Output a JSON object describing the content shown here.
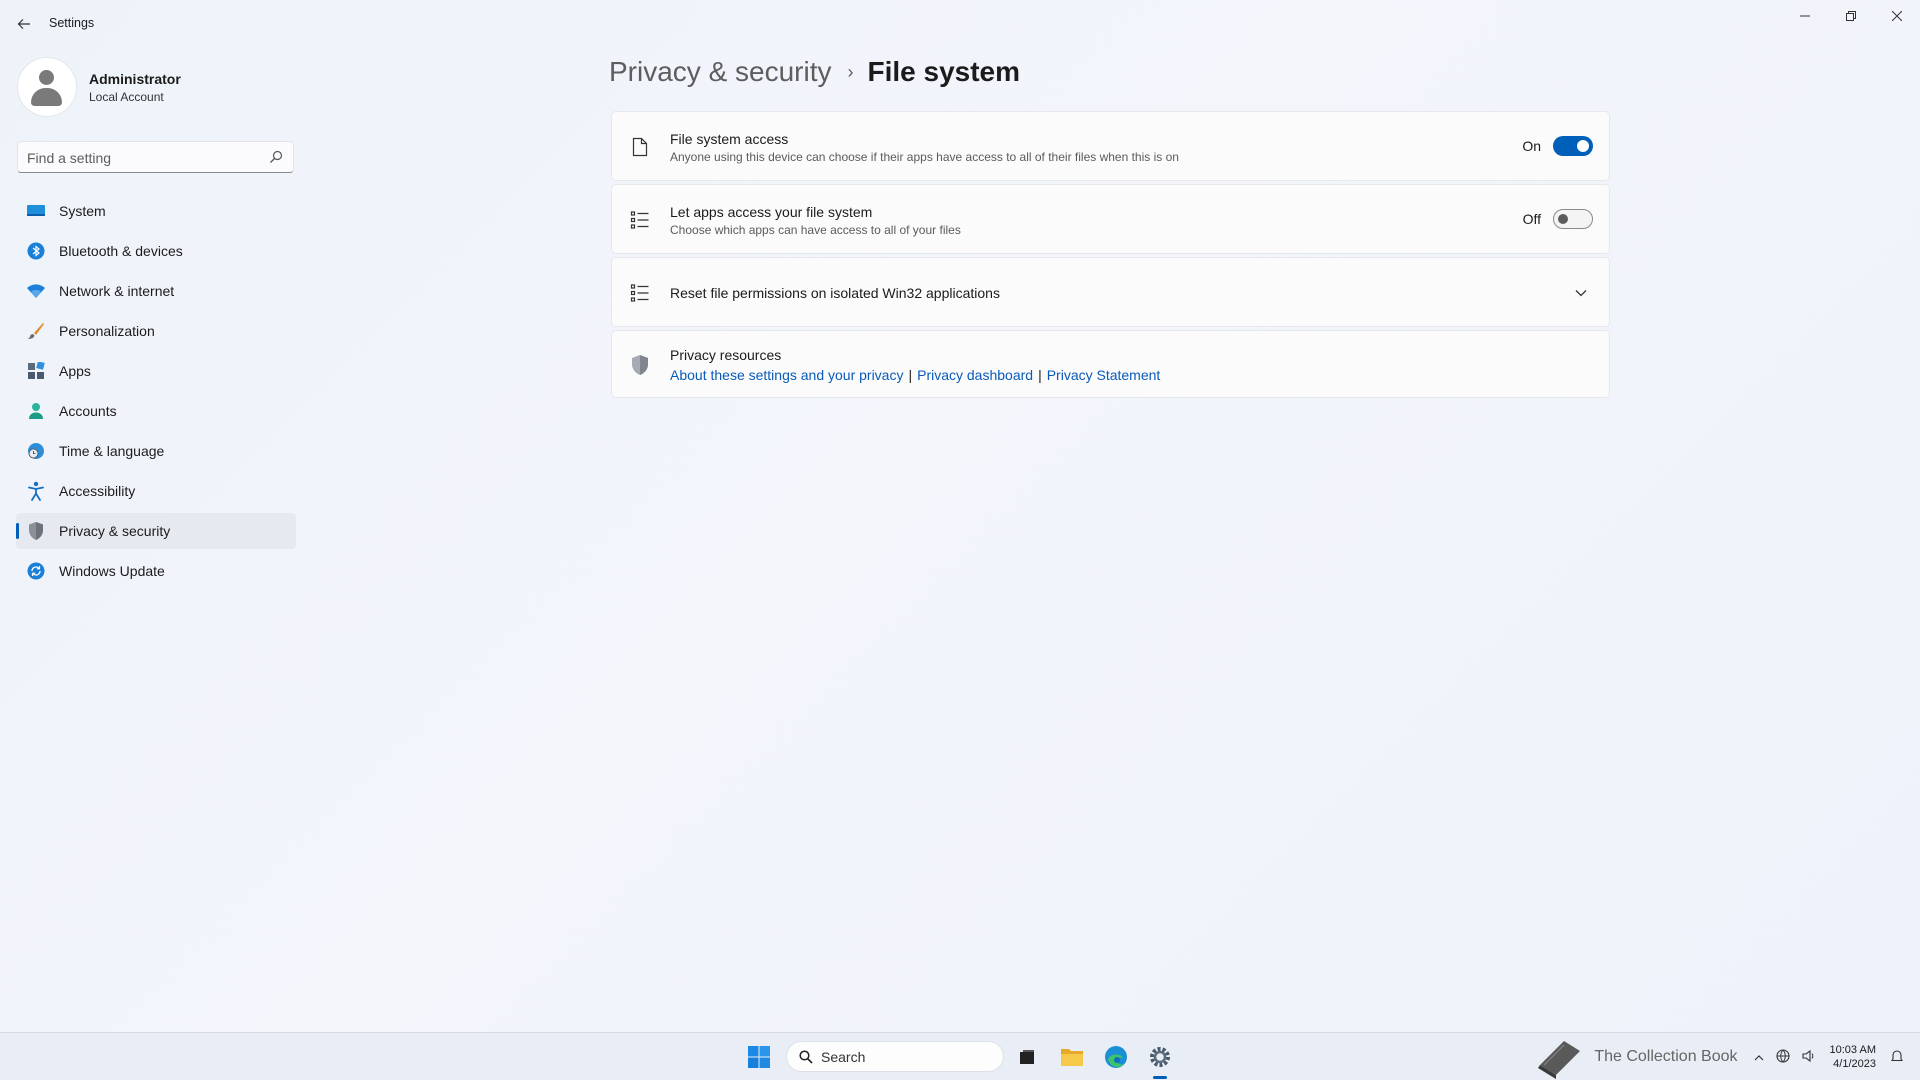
{
  "window": {
    "app_title": "Settings",
    "controls": {
      "minimize": "—",
      "restore": "❐",
      "close": "✕"
    }
  },
  "profile": {
    "name": "Administrator",
    "account_type": "Local Account"
  },
  "search": {
    "placeholder": "Find a setting"
  },
  "nav": {
    "items": [
      {
        "label": "System",
        "icon": "system-icon"
      },
      {
        "label": "Bluetooth & devices",
        "icon": "bluetooth-icon"
      },
      {
        "label": "Network & internet",
        "icon": "wifi-icon"
      },
      {
        "label": "Personalization",
        "icon": "brush-icon"
      },
      {
        "label": "Apps",
        "icon": "apps-icon"
      },
      {
        "label": "Accounts",
        "icon": "person-icon"
      },
      {
        "label": "Time & language",
        "icon": "globe-clock-icon"
      },
      {
        "label": "Accessibility",
        "icon": "accessibility-icon"
      },
      {
        "label": "Privacy & security",
        "icon": "shield-icon",
        "selected": true
      },
      {
        "label": "Windows Update",
        "icon": "update-icon"
      }
    ]
  },
  "breadcrumb": {
    "parent": "Privacy & security",
    "separator": "›",
    "current": "File system"
  },
  "cards": {
    "file_system_access": {
      "title": "File system access",
      "description": "Anyone using this device can choose if their apps have access to all of their files when this is on",
      "state_label": "On",
      "on": true,
      "icon": "document-icon"
    },
    "let_apps_access": {
      "title": "Let apps access your file system",
      "description": "Choose which apps can have access to all of your files",
      "state_label": "Off",
      "on": false,
      "icon": "list-icon"
    },
    "reset_permissions": {
      "title": "Reset file permissions on isolated Win32 applications",
      "icon": "list-icon"
    },
    "privacy_resources": {
      "title": "Privacy resources",
      "links": [
        "About these settings and your privacy",
        "Privacy dashboard",
        "Privacy Statement"
      ],
      "separator": "|",
      "icon": "shield-icon"
    }
  },
  "taskbar": {
    "search_label": "Search",
    "tray_overlay_text": "The Collection Book",
    "time": "10:03 AM",
    "date": "4/1/2023"
  },
  "colors": {
    "accent": "#005fb8",
    "link": "#0a5bb8",
    "background": "#f0f3f9"
  }
}
